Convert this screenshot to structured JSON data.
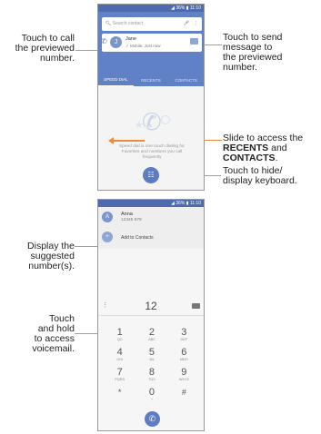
{
  "annotations": {
    "call": [
      "Touch to call",
      "the previewed",
      "number."
    ],
    "send": [
      "Touch to send",
      "message to",
      "the previewed",
      "number."
    ],
    "slide_1": "Slide to access the",
    "slide_recents": "RECENTS",
    "slide_and": " and",
    "slide_contacts": "CONTACTS",
    "slide_end": ".",
    "keyboard": [
      "Touch to hide/",
      "display keyboard."
    ],
    "suggested": [
      "Display the",
      "suggested",
      "number(s)."
    ],
    "voicemail": [
      "Touch",
      "and hold",
      "to access",
      "voicemail."
    ]
  },
  "screen1": {
    "status": "◢ 36% ▮ 11:10",
    "search_placeholder": "Search contact",
    "contact_initial": "J",
    "contact_name": "Jane",
    "contact_sub": "✓ Mobile, Just now",
    "tabs": [
      "SPEED DIAL",
      "RECENTS",
      "CONTACTS"
    ],
    "empty_text": "Speed dial is one touch dialing for Favorites and numbers you call frequently"
  },
  "screen2": {
    "status": "◢ 36% ▮ 11:10",
    "suggest_initial": "A",
    "suggest_name": "Anna",
    "suggest_number": "12345 678",
    "add_contacts": "Add to Contacts",
    "dialed": "12",
    "keys": [
      {
        "d": "1",
        "l": "QO"
      },
      {
        "d": "2",
        "l": "ABC"
      },
      {
        "d": "3",
        "l": "DEF"
      },
      {
        "d": "4",
        "l": "GHI"
      },
      {
        "d": "5",
        "l": "JKL"
      },
      {
        "d": "6",
        "l": "MNO"
      },
      {
        "d": "7",
        "l": "PQRS"
      },
      {
        "d": "8",
        "l": "TUV"
      },
      {
        "d": "9",
        "l": "WXYZ"
      },
      {
        "d": "*",
        "l": ""
      },
      {
        "d": "0",
        "l": "+"
      },
      {
        "d": "#",
        "l": ""
      }
    ]
  },
  "colors": {
    "accent": "#6181c6",
    "status": "#4f6bb0",
    "pointer": "#f08a3a"
  }
}
